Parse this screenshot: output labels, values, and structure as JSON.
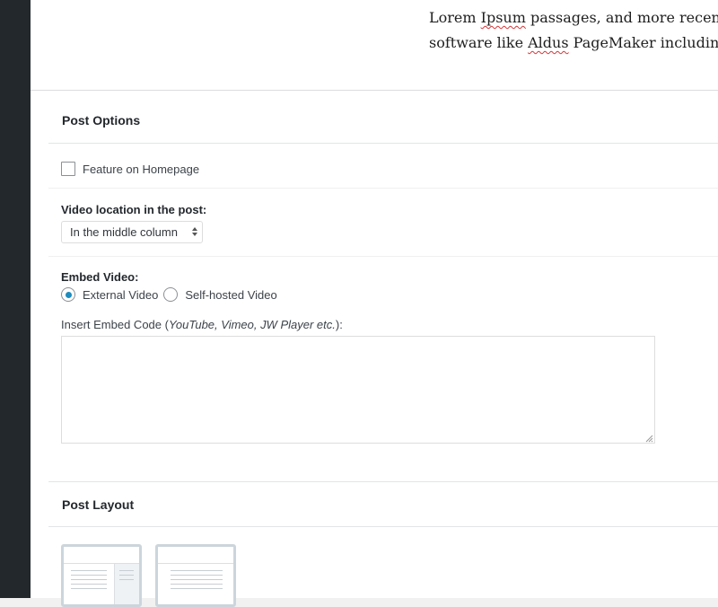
{
  "editor": {
    "line1": {
      "w1": "Lorem",
      "w2": "Ipsum",
      "rest": "passages, and more recently"
    },
    "line2": {
      "w1": "software like",
      "w2": "Aldus",
      "rest": "PageMaker including v"
    }
  },
  "post_options": {
    "title": "Post Options",
    "feature_label": "Feature on Homepage",
    "feature_checked": false,
    "video_location_label": "Video location in the post:",
    "video_location_value": "In the middle column",
    "embed_video_label": "Embed Video:",
    "radio_external": "External Video",
    "radio_selfhosted": "Self-hosted Video",
    "radio_selected": "External Video",
    "embed_code_prefix": "Insert Embed Code (",
    "embed_code_italic": "YouTube, Vimeo, JW Player etc.",
    "embed_code_suffix": "):",
    "embed_code_value": ""
  },
  "post_layout": {
    "title": "Post Layout",
    "options": [
      "layout-sidebar-right",
      "layout-full-width"
    ]
  },
  "colors": {
    "admin_bar": "#23282d",
    "radio_accent": "#1e8cbe",
    "spellcheck": "#d63638"
  }
}
